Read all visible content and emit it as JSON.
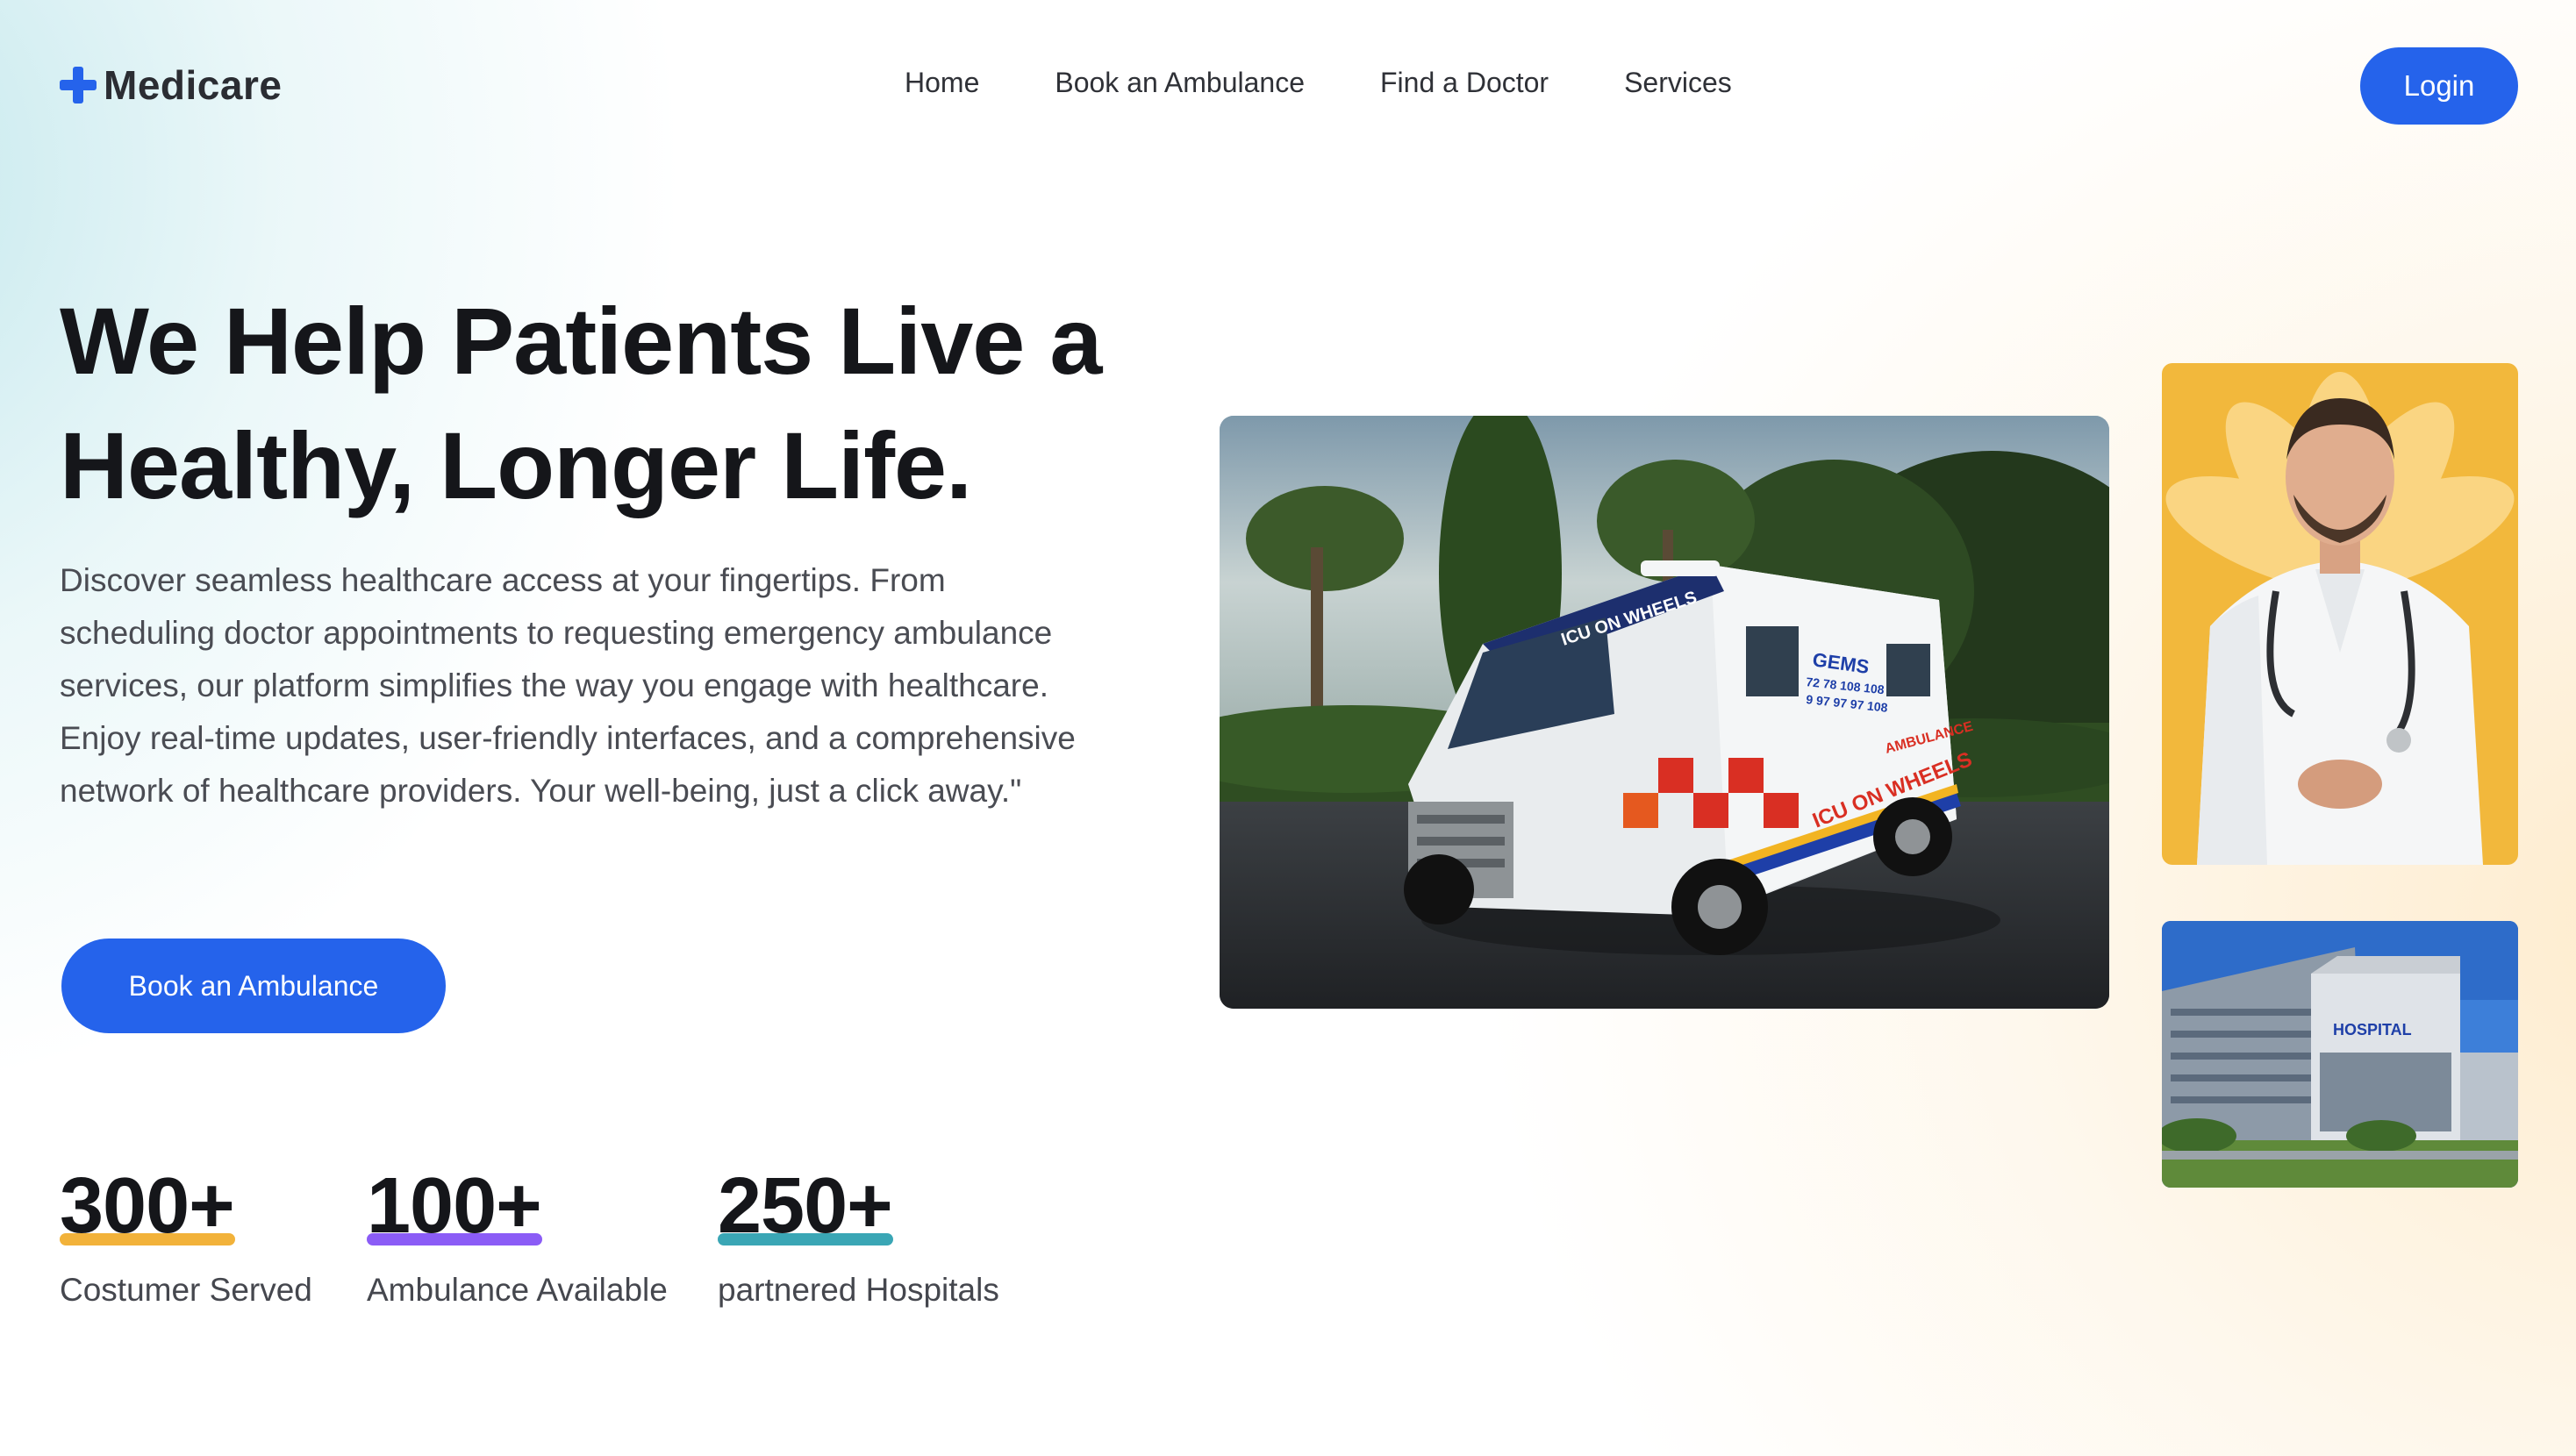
{
  "brand": {
    "name": "Medicare",
    "icon": "plus-cross-icon",
    "accent_color": "#2563eb"
  },
  "nav": {
    "links": [
      "Home",
      "Book an Ambulance",
      "Find a Doctor",
      "Services"
    ],
    "login_label": "Login"
  },
  "hero": {
    "title_line1": "We Help Patients Live a",
    "title_line2": "Healthy, Longer Life.",
    "description": "Discover seamless healthcare access at your fingertips. From scheduling doctor appointments to requesting emergency ambulance services, our platform simplifies the way you engage with healthcare. Enjoy real-time updates, user-friendly interfaces, and a comprehensive network of healthcare providers. Your well-being, just a click away.\"",
    "cta_label": "Book an Ambulance"
  },
  "stats": [
    {
      "value": "300+",
      "label": "Costumer Served",
      "underline_color": "#f2b23a"
    },
    {
      "value": "100+",
      "label": "Ambulance Available",
      "underline_color": "#8b5cf6"
    },
    {
      "value": "250+",
      "label": "partnered Hospitals",
      "underline_color": "#3aa6b5"
    }
  ],
  "images": {
    "ambulance": {
      "sign_top": "ICU ON WHEELS",
      "sign_side": "ICU ON WHEELS",
      "sign_brand": "GEMS",
      "sign_phone1": "72 78 108 108",
      "sign_phone2": "9 97 97 97 108",
      "sign_type": "AMBULANCE"
    },
    "doctor": {},
    "hospital": {
      "sign": "HOSPITAL"
    }
  }
}
